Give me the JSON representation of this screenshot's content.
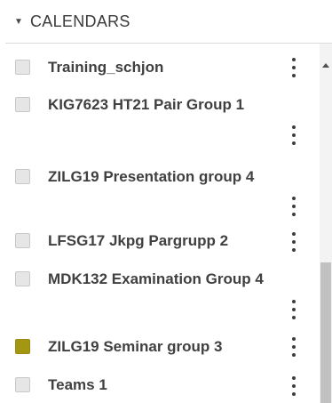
{
  "header": {
    "caret_glyph": "▼",
    "title": "CALENDARS"
  },
  "calendars": [
    {
      "name": "Training_schjon",
      "checked": false,
      "color": "#e6e6e6"
    },
    {
      "name": "KIG7623 HT21 Pair Group 1",
      "checked": false,
      "color": "#e6e6e6"
    },
    {
      "name": "ZILG19 Presentation group 4",
      "checked": false,
      "color": "#e6e6e6"
    },
    {
      "name": "LFSG17 Jkpg Pargrupp 2",
      "checked": false,
      "color": "#e6e6e6"
    },
    {
      "name": "MDK132 Examination Group 4",
      "checked": false,
      "color": "#e6e6e6"
    },
    {
      "name": "ZILG19 Seminar group 3",
      "checked": true,
      "color": "#a39612"
    },
    {
      "name": "Teams 1",
      "checked": false,
      "color": "#e6e6e6"
    }
  ],
  "icons": {
    "caret": "caret-down-icon",
    "options": "kebab-menu-icon",
    "scroll_up": "arrow-up-icon"
  }
}
